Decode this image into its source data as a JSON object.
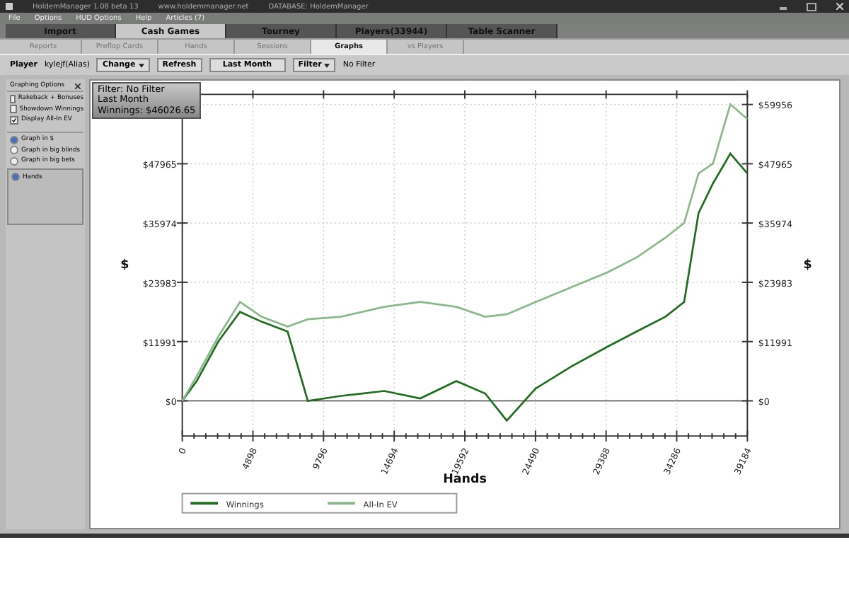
{
  "window": {
    "title": "HoldemManager 1.08 beta 13",
    "website": "www.holdemmanager.net",
    "database": "DATABASE: HoldemManager"
  },
  "menu": [
    "File",
    "Options",
    "HUD Options",
    "Help",
    "Articles (7)"
  ],
  "tabs": [
    {
      "label": "Import",
      "selected": false
    },
    {
      "label": "Cash Games",
      "selected": true
    },
    {
      "label": "Tourney",
      "selected": false
    },
    {
      "label": "Players(33944)",
      "selected": false
    },
    {
      "label": "Table Scanner",
      "selected": false
    }
  ],
  "subtabs": [
    {
      "label": "Reports",
      "selected": false
    },
    {
      "label": "Preflop Cards",
      "selected": false
    },
    {
      "label": "Hands",
      "selected": false
    },
    {
      "label": "Sessions",
      "selected": false
    },
    {
      "label": "Graphs",
      "selected": true
    },
    {
      "label": "vs Players",
      "selected": false
    }
  ],
  "toolbar": {
    "player_label": "Player",
    "player": "kylejf(Alias)",
    "change": "Change",
    "refresh": "Refresh",
    "period": "Last Month",
    "filter": "Filter",
    "filter_value": "No Filter"
  },
  "options": {
    "title": "Graphing Options",
    "checks": [
      {
        "label": "Rakeback + Bonuses",
        "checked": false
      },
      {
        "label": "Showdown Winnings",
        "checked": false
      },
      {
        "label": "Display All-In EV",
        "checked": true
      }
    ],
    "units": [
      {
        "label": "Graph in $",
        "selected": true
      },
      {
        "label": "Graph in big blinds",
        "selected": false
      },
      {
        "label": "Graph in big bets",
        "selected": false
      }
    ],
    "axis": [
      {
        "label": "Hands",
        "selected": true
      }
    ]
  },
  "info": [
    "Filter: No Filter",
    "Last Month",
    "Winnings: $46026.65"
  ],
  "y_axis_label": "$",
  "chart_data": {
    "type": "line",
    "xlabel": "Hands",
    "ylabel": "$",
    "x": [
      0,
      1000,
      2500,
      4000,
      5500,
      7300,
      8700,
      11000,
      14000,
      16500,
      19000,
      21000,
      22500,
      24500,
      27000,
      29500,
      31500,
      33500,
      34800,
      35800,
      36800,
      38000,
      39184
    ],
    "series": [
      {
        "name": "Winnings",
        "color": "#1e6e1e",
        "values": [
          0,
          4000,
          12000,
          18000,
          16000,
          14000,
          0,
          1000,
          2000,
          500,
          4000,
          1500,
          -4000,
          2500,
          7000,
          11000,
          14000,
          17000,
          20000,
          38000,
          44000,
          50000,
          46000
        ]
      },
      {
        "name": "All-In EV",
        "color": "#8ab88a",
        "values": [
          0,
          5000,
          13000,
          20000,
          17000,
          15000,
          16500,
          17000,
          19000,
          20000,
          19000,
          17000,
          17500,
          20000,
          23000,
          26000,
          29000,
          33000,
          36000,
          46000,
          48000,
          60000,
          57000
        ]
      }
    ],
    "grid": true,
    "legend": true,
    "xlim": [
      0,
      39184
    ],
    "ylim": [
      -6000,
      62000
    ],
    "xticks": [
      0,
      4898,
      9796,
      14694,
      19592,
      24490,
      29388,
      34286,
      39184
    ],
    "yticks": [
      {
        "value": 0,
        "label": "$0"
      },
      {
        "value": 11991,
        "label": "$11991"
      },
      {
        "value": 23983,
        "label": "$23983"
      },
      {
        "value": 35974,
        "label": "$35974"
      },
      {
        "value": 47965,
        "label": "$47965"
      },
      {
        "value": 59956,
        "label": "$59956"
      }
    ]
  }
}
